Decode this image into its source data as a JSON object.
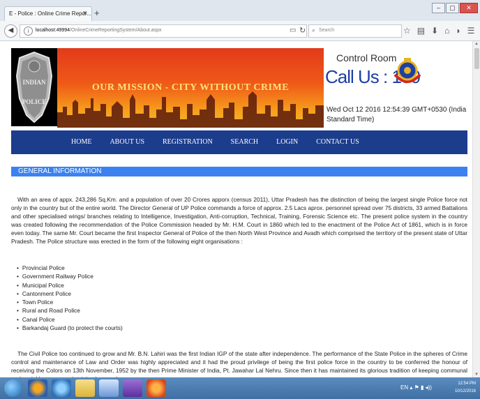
{
  "browser": {
    "tab_title": "E - Police : Online Crime Repor...",
    "tab_close": "×",
    "new_tab": "+",
    "url_host": "localhost:49994",
    "url_path": "/OnlineCrimeReportingSystem/About.aspx",
    "search_placeholder": "Search",
    "window_buttons": [
      "–",
      "▢",
      "✕"
    ]
  },
  "header": {
    "mission_text": "OUR MISSION - CITY WITHOUT CRIME",
    "control_room": "Control Room",
    "call_us": "Call Us : 100",
    "datetime": "Wed Oct 12 2016 12:54:39 GMT+0530 (India Standard Time)",
    "badge_text": [
      "INDIAN",
      "POLICE"
    ]
  },
  "menu": {
    "items": [
      "HOME",
      "ABOUT US",
      "REGISTRATION",
      "SEARCH",
      "LOGIN",
      "CONTACT US"
    ]
  },
  "section": {
    "title": "GENERAL INFORMATION"
  },
  "content": {
    "paragraph1": "With an area of appx. 243,286 Sq.Km. and a population of over 20 Crores apporx (census 2011), Uttar Pradesh has the distinction of being the largest single Police force not only in the country but of the entire world. The Director General of UP Police commands a force of approx. 2.5 Lacs aprox. personnel spread over 75 districts, 33 armed Battalions and other specialised wings/ branches relating to Intelligence, Investigation, Anti-corruption, Technical, Training, Forensic Science etc. The present police system in the country was created following the recommendation of the Police Commission headed by Mr. H.M. Court in 1860 which led to the enactment of the Police Act of 1861, which is in force even today. The same Mr. Court became the first Inspector General of Police of the then North West Province and Avadh which comprised the territory of the present state of Uttar Pradesh. The Police structure was erected in the form of the following eight organisations :",
    "units": [
      "Provincial Police",
      "Government Railway Police",
      "Municipal Police",
      "Cantonment Police",
      "Town Police",
      "Rural and Road Police",
      "Canal Police",
      "Barkandaj Guard (to protect the courts)"
    ],
    "paragraph2": "The Civil Police too continued to grow and Mr. B.N. Lahiri was the first Indian IGP of the state after independence. The performance of the State Police in the spheres of Crime control and maintenance of Law and Order was highly appreciated and it had the proud privilege of being the first police force in the country to be conferred the honour of receiving the Colors on 13th November, 1952 by the then Prime Minister of India, Pt. Jawahar Lal Nehru. Since then it has maintained its glorious tradition of keeping communal and social harmony, maintaining Law and"
  },
  "taskbar": {
    "lang": "EN",
    "time": "12:54 PM",
    "date": "10/12/2016"
  },
  "colors": {
    "menu_bg": "#1c3c8c",
    "section_bar": "#3b82f0",
    "call_us": "#1f3fa6"
  }
}
